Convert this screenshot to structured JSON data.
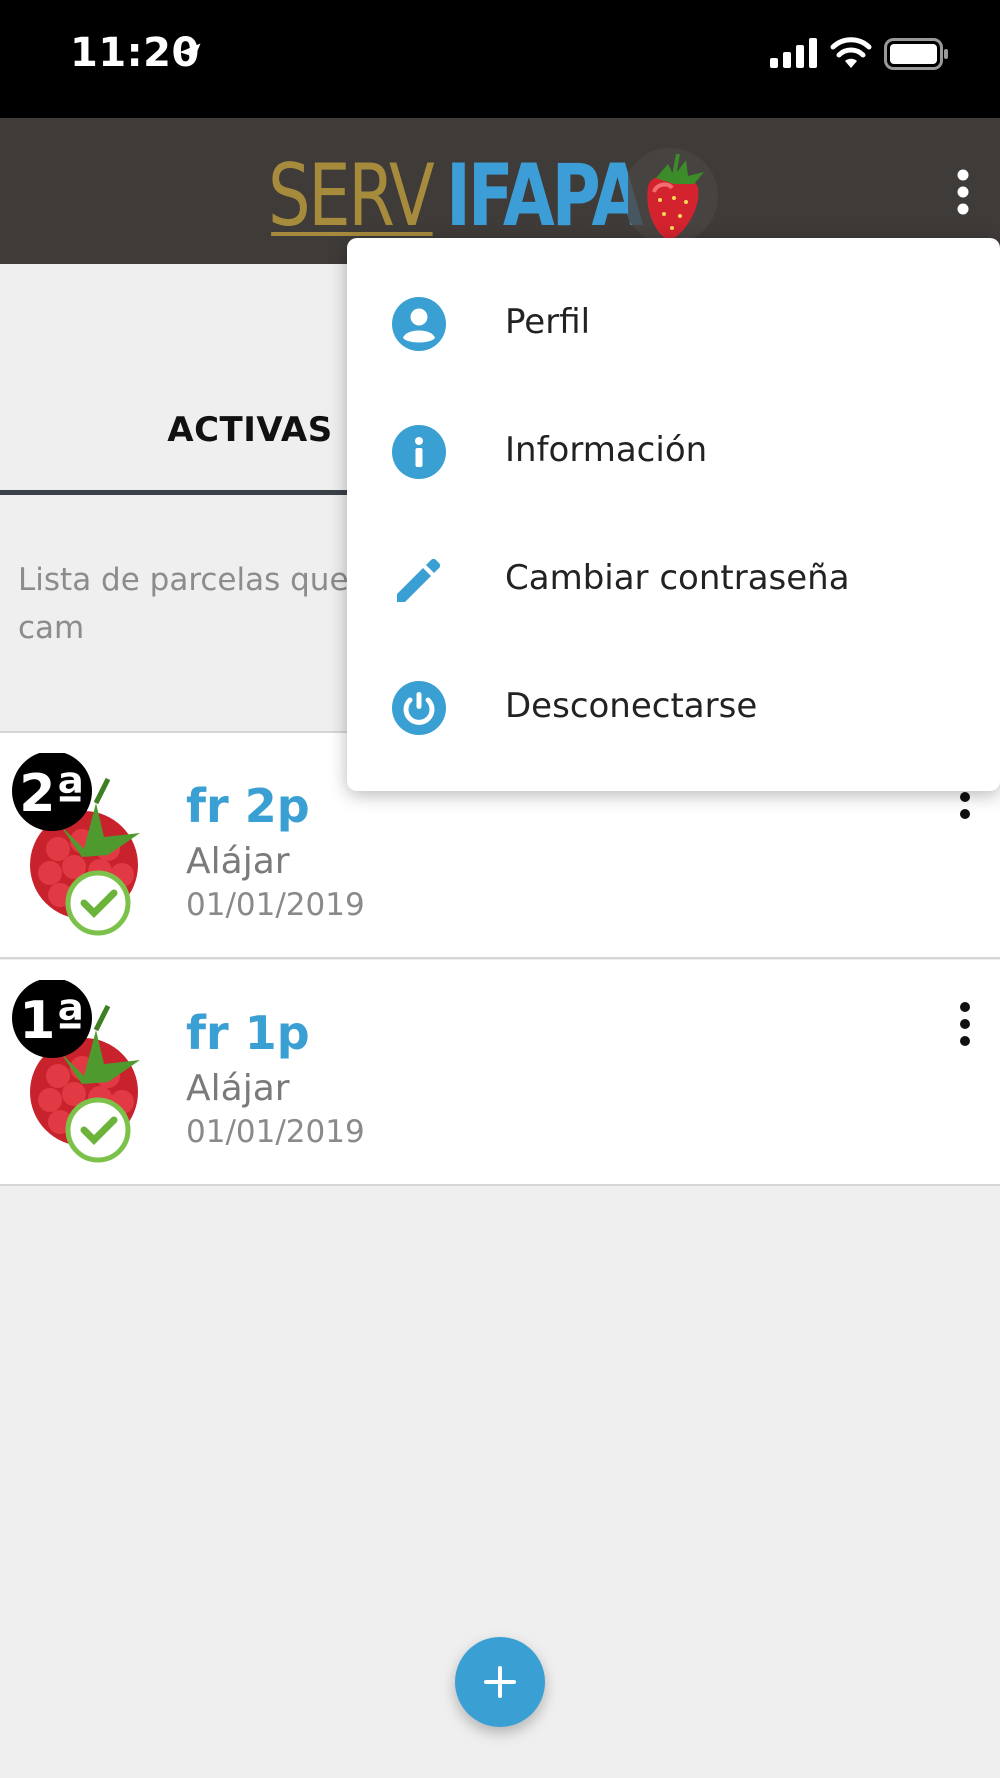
{
  "status_bar": {
    "time": "11:20",
    "icons": [
      "location-arrow-icon",
      "cellular-signal-icon",
      "wifi-icon",
      "battery-icon"
    ]
  },
  "header": {
    "logo_text_part1": "SERV",
    "logo_text_part2": "IFAPA",
    "menu_icon": "more-vertical-icon"
  },
  "tabs": {
    "active_label": "ACTIVAS"
  },
  "description": "Lista de parcelas que configuración de su riego y finalice la cam",
  "list": {
    "items": [
      {
        "badge": "2ª",
        "title": "fr 2p",
        "location": "Alájar",
        "date": "01/01/2019",
        "icon": "raspberry-check-icon"
      },
      {
        "badge": "1ª",
        "title": "fr 1p",
        "location": "Alájar",
        "date": "01/01/2019",
        "icon": "raspberry-check-icon"
      }
    ]
  },
  "menu": {
    "items": [
      {
        "label": "Perfil",
        "icon": "user-circle-icon"
      },
      {
        "label": "Información",
        "icon": "info-circle-icon"
      },
      {
        "label": "Cambiar contraseña",
        "icon": "pencil-icon"
      },
      {
        "label": "Desconectarse",
        "icon": "power-icon"
      }
    ]
  },
  "fab": {
    "icon": "plus-icon"
  },
  "colors": {
    "accent": "#3aa0d3",
    "header_bg": "#3e3b39",
    "logo_gold": "#a78b3d",
    "logo_blue": "#3d9dd6"
  }
}
